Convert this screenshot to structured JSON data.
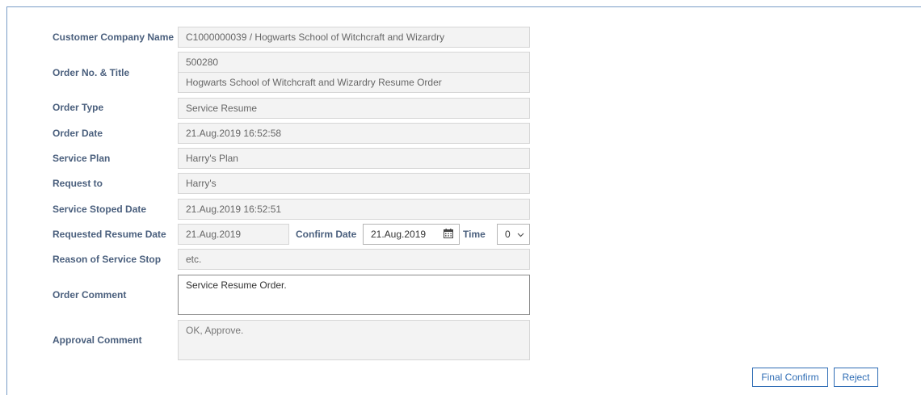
{
  "form": {
    "customer_company": {
      "label": "Customer Company Name",
      "value": "C1000000039 / Hogwarts School of Witchcraft and Wizardry"
    },
    "order_no_title": {
      "label": "Order No. & Title",
      "order_no": "500280",
      "title": "Hogwarts School of Witchcraft and Wizardry Resume Order"
    },
    "order_type": {
      "label": "Order Type",
      "value": "Service Resume"
    },
    "order_date": {
      "label": "Order Date",
      "value": "21.Aug.2019 16:52:58"
    },
    "service_plan": {
      "label": "Service Plan",
      "value": "Harry's Plan"
    },
    "request_to": {
      "label": "Request to",
      "value": "Harry's"
    },
    "service_stoped_date": {
      "label": "Service Stoped Date",
      "value": "21.Aug.2019 16:52:51"
    },
    "requested_resume_date": {
      "label": "Requested Resume Date",
      "value": "21.Aug.2019",
      "confirm_label": "Confirm Date",
      "confirm_value": "21.Aug.2019",
      "time_label": "Time",
      "time_value": "0"
    },
    "reason_of_service_stop": {
      "label": "Reason of Service Stop",
      "value": "etc."
    },
    "order_comment": {
      "label": "Order Comment",
      "value": "Service Resume Order."
    },
    "approval_comment": {
      "label": "Approval Comment",
      "value": "OK, Approve."
    }
  },
  "actions": {
    "final_confirm_label": "Final Confirm",
    "reject_label": "Reject"
  },
  "colors": {
    "label": "#4a5f7d",
    "accent": "#2f6db5",
    "field_bg": "#f3f3f3"
  },
  "icons": {
    "calendar": "calendar-icon",
    "dropdown": "chevron-down-icon"
  }
}
